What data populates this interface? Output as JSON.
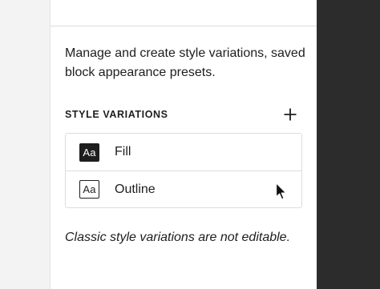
{
  "panel": {
    "description": "Manage and create style variations, saved block appearance presets.",
    "section_title": "STYLE VARIATIONS",
    "add_icon": "plus-icon",
    "variations": [
      {
        "badge": "Aa",
        "label": "Fill",
        "style": "fill"
      },
      {
        "badge": "Aa",
        "label": "Outline",
        "style": "outline"
      }
    ],
    "note": "Classic style variations are not editable."
  },
  "cursor_icon": "arrow-pointer-icon"
}
